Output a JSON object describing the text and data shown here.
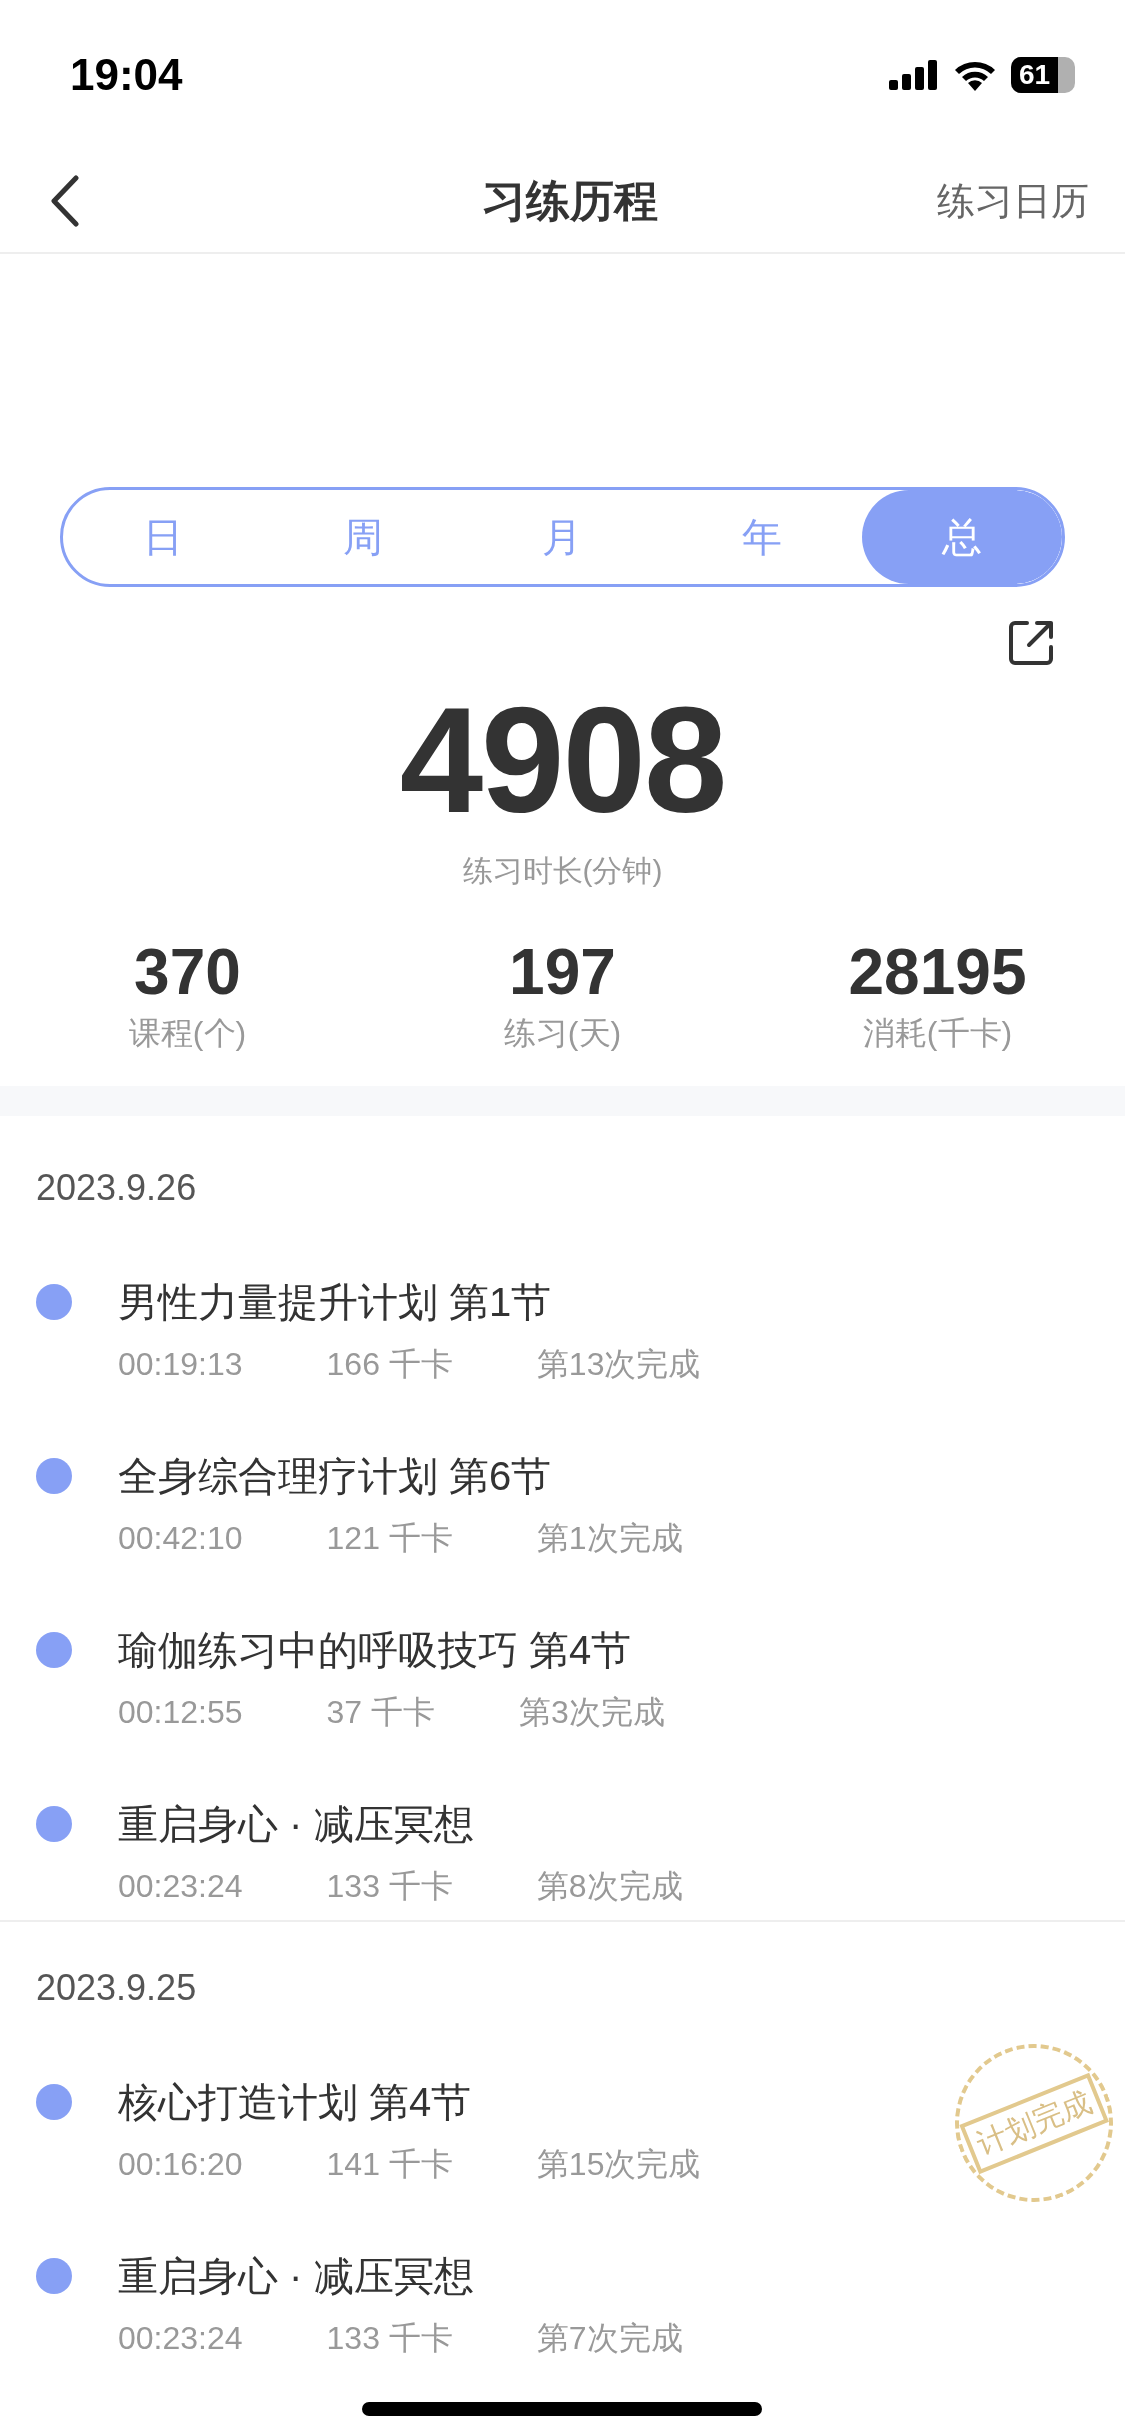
{
  "status_bar": {
    "time": "19:04",
    "battery": "61"
  },
  "header": {
    "title": "习练历程",
    "action": "练习日历"
  },
  "tabs": [
    {
      "label": "日",
      "selected": false
    },
    {
      "label": "周",
      "selected": false
    },
    {
      "label": "月",
      "selected": false
    },
    {
      "label": "年",
      "selected": false
    },
    {
      "label": "总",
      "selected": true
    }
  ],
  "summary": {
    "value": "4908",
    "label": "练习时长(分钟)"
  },
  "stats": [
    {
      "value": "370",
      "label": "课程(个)"
    },
    {
      "value": "197",
      "label": "练习(天)"
    },
    {
      "value": "28195",
      "label": "消耗(千卡)"
    }
  ],
  "days": [
    {
      "date": "2023.9.26",
      "items": [
        {
          "title": "男性力量提升计划 第1节",
          "duration": "00:19:13",
          "calories": "166 千卡",
          "count": "第13次完成",
          "color": "#87a0f5"
        },
        {
          "title": "全身综合理疗计划 第6节",
          "duration": "00:42:10",
          "calories": "121 千卡",
          "count": "第1次完成",
          "color": "#87a0f5"
        },
        {
          "title": "瑜伽练习中的呼吸技巧 第4节",
          "duration": "00:12:55",
          "calories": "37 千卡",
          "count": "第3次完成",
          "color": "#87a0f5"
        },
        {
          "title": "重启身心 · 减压冥想",
          "duration": "00:23:24",
          "calories": "133 千卡",
          "count": "第8次完成",
          "color": "#87a0f5"
        }
      ]
    },
    {
      "date": "2023.9.25",
      "items": [
        {
          "title": "核心打造计划 第4节",
          "duration": "00:16:20",
          "calories": "141 千卡",
          "count": "第15次完成",
          "color": "#87a0f5",
          "stamp": "计划完成"
        },
        {
          "title": "重启身心 · 减压冥想",
          "duration": "00:23:24",
          "calories": "133 千卡",
          "count": "第7次完成",
          "color": "#87a0f5"
        }
      ]
    }
  ]
}
